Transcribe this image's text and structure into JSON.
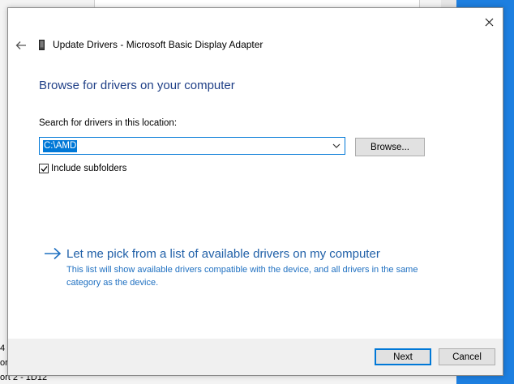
{
  "background": {
    "left_fragments": [
      "4",
      "or",
      "ort 2 - 1D12"
    ]
  },
  "dialog": {
    "title": "Update Drivers - Microsoft Basic Display Adapter",
    "close_glyph": "✕",
    "heading": "Browse for drivers on your computer",
    "search_label": "Search for drivers in this location:",
    "location_value": "C:\\AMD",
    "browse_label": "Browse...",
    "include_subfolders_label": "Include subfolders",
    "include_subfolders_checked": true,
    "pick_title": "Let me pick from a list of available drivers on my computer",
    "pick_description": "This list will show available drivers compatible with the device, and all drivers in the same category as the device.",
    "next_label": "Next",
    "cancel_label": "Cancel"
  },
  "colors": {
    "accent": "#0078d7",
    "heading": "#1f3f87",
    "link": "#2060a8",
    "desktop_edge": "#1d7fe0"
  },
  "icons": {
    "back": "arrow-left-icon",
    "device": "display-adapter-icon",
    "dropdown": "chevron-down-icon",
    "pick": "arrow-right-icon"
  }
}
